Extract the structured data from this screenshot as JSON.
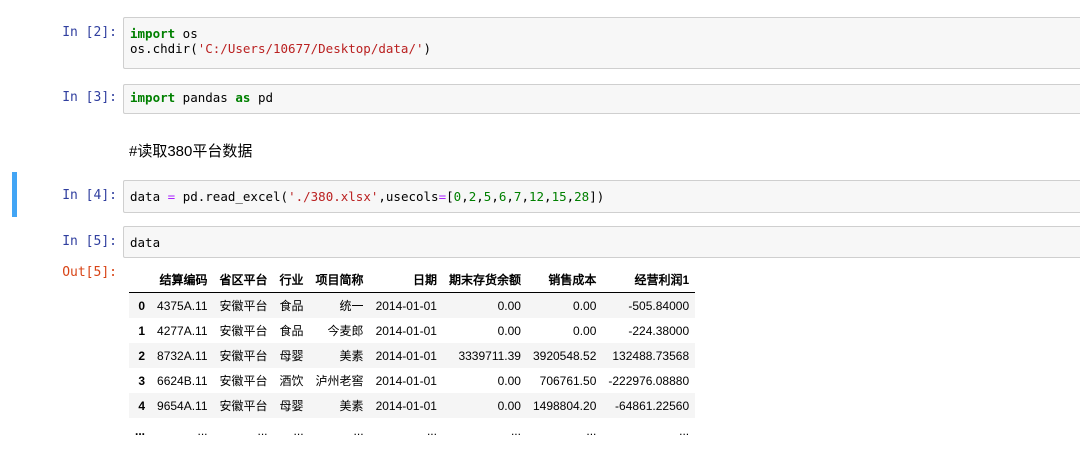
{
  "cells": {
    "c2": {
      "prompt": "In [2]:",
      "line1": {
        "kw": "import",
        "rest": " os"
      },
      "line2": {
        "pre": "os.chdir(",
        "str": "'C:/Users/10677/Desktop/data/'",
        "post": ")"
      }
    },
    "c3": {
      "prompt": "In [3]:",
      "kw1": "import",
      "mid": " pandas ",
      "kw2": "as",
      "post": " pd"
    },
    "markdown": "#读取380平台数据",
    "c4": {
      "prompt": "In [4]:",
      "p1": "data ",
      "eq": "=",
      "p2": " pd.read_excel(",
      "str": "'./380.xlsx'",
      "p3": ",usecols",
      "eq2": "=",
      "p4": "[",
      "nums": [
        "0",
        "2",
        "5",
        "6",
        "7",
        "12",
        "15",
        "28"
      ],
      "p5": "])"
    },
    "c5": {
      "prompt": "In [5]:",
      "code": "data"
    },
    "out5": {
      "prompt": "Out[5]:"
    }
  },
  "table": {
    "columns": [
      "",
      "结算编码",
      "省区平台",
      "行业",
      "项目简称",
      "日期",
      "期末存货余额",
      "销售成本",
      "经营利润1"
    ],
    "rows": [
      [
        "0",
        "4375A.11",
        "安徽平台",
        "食品",
        "统一",
        "2014-01-01",
        "0.00",
        "0.00",
        "-505.84000"
      ],
      [
        "1",
        "4277A.11",
        "安徽平台",
        "食品",
        "今麦郎",
        "2014-01-01",
        "0.00",
        "0.00",
        "-224.38000"
      ],
      [
        "2",
        "8732A.11",
        "安徽平台",
        "母婴",
        "美素",
        "2014-01-01",
        "3339711.39",
        "3920548.52",
        "132488.73568"
      ],
      [
        "3",
        "6624B.11",
        "安徽平台",
        "酒饮",
        "泸州老窖",
        "2014-01-01",
        "0.00",
        "706761.50",
        "-222976.08880"
      ],
      [
        "4",
        "9654A.11",
        "安徽平台",
        "母婴",
        "美素",
        "2014-01-01",
        "0.00",
        "1498804.20",
        "-64861.22560"
      ],
      [
        "...",
        "...",
        "...",
        "...",
        "...",
        "...",
        "...",
        "...",
        "..."
      ]
    ]
  }
}
